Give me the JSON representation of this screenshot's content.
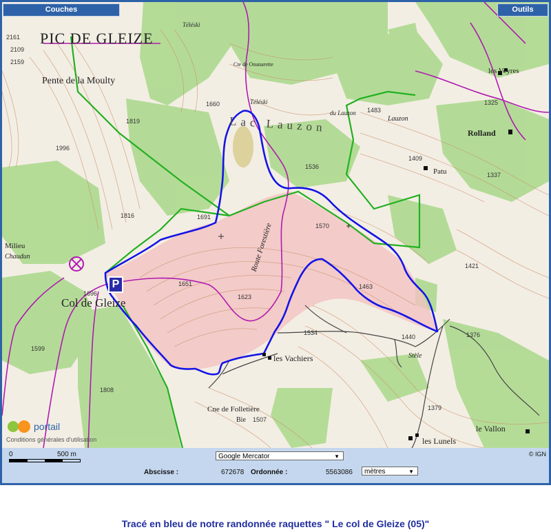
{
  "toolbar": {
    "layers_label": "Couches",
    "tools_label": "Outils"
  },
  "map": {
    "place_labels": {
      "pic": "PIC DE GLEIZE",
      "pente": "Pente de la Moulty",
      "col": "Col de Gleize",
      "vachiers": "les Vachiers",
      "folletiere": "Cne de Folletière",
      "bie": "Bie",
      "lunels": "les Lunels",
      "vallon": "le Vallon",
      "rolland": "Rolland",
      "patu": "Patu",
      "veyres": "les Veyres",
      "onanarette": "Cte de Onanarette",
      "teleski1": "Téléski",
      "teleski2": "Téléski",
      "lauzon": "Lauzon",
      "lac_lauzon": "Lac Lauzon",
      "route": "Route Forestière",
      "stele": "Stèle",
      "milieu": "Milieu",
      "chaudun": "Chaudun",
      "lauzon_river": "du Lauzon"
    },
    "altitudes": {
      "a2161": "2161",
      "a2109": "2109",
      "a2159": "2159",
      "a1819": "1819",
      "a1996": "1996",
      "a1816": "1816",
      "a1691": "1691",
      "a1660": "1660",
      "a1483": "1483",
      "a1536": "1536",
      "a1409": "1409",
      "a1337": "1337",
      "a1325": "1325",
      "a1570": "1570",
      "a1421": "1421",
      "a1651": "1651",
      "a1623": "1623",
      "a1696": "1696",
      "a1599": "1599",
      "a1808": "1808",
      "a1534": "1534",
      "a1463": "1463",
      "a1440": "1440",
      "a1376": "1376",
      "a1507": "1507",
      "a1379": "1379"
    },
    "parking_symbol": "P",
    "logo_text": "portail",
    "logo_sub": "Conditions générales d'utilisation",
    "route_color": "#1414e6",
    "boundary_color": "#22b022",
    "road_color": "#b01ab0"
  },
  "scale": {
    "zero": "0",
    "distance": "500 m"
  },
  "projection": {
    "selected": "Google Mercator"
  },
  "coords": {
    "abscisse_label": "Abscisse :",
    "abscisse_value": "672678",
    "ordonnee_label": "Ordonnée :",
    "ordonnee_value": "5563086",
    "unit": "mètres"
  },
  "copyright": "© IGN",
  "caption": "Tracé en bleu de notre randonnée raquettes \" Le col de Gleize (05)\""
}
